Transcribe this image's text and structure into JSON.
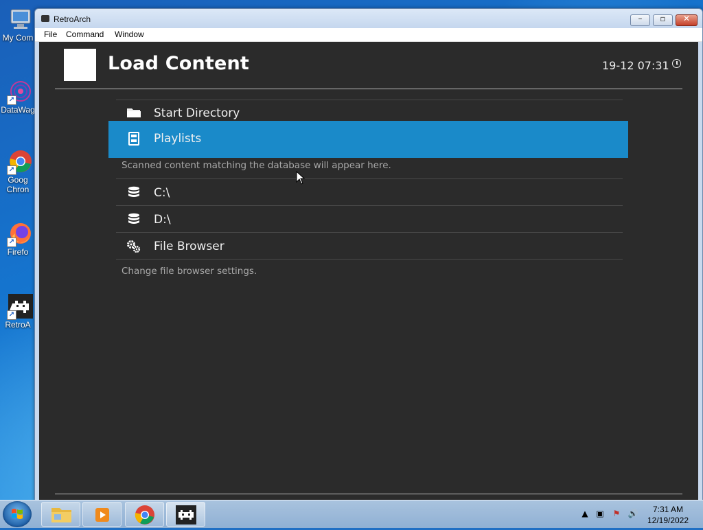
{
  "desktop": {
    "icons": [
      {
        "label": "My Com",
        "icon": "computer-icon"
      },
      {
        "label": "DataWag",
        "icon": "datawagon-icon"
      },
      {
        "label": "Goog",
        "label2": "Chron",
        "icon": "chrome-icon"
      },
      {
        "label": "Firefo",
        "icon": "firefox-icon"
      },
      {
        "label": "RetroA",
        "icon": "retroarch-icon"
      }
    ]
  },
  "window": {
    "title": "RetroArch",
    "menu": [
      "File",
      "Command",
      "Window"
    ]
  },
  "retroarch": {
    "page_title": "Load Content",
    "clock": "19-12 07:31",
    "entries": [
      {
        "label": "Start Directory",
        "icon": "folder-icon"
      },
      {
        "label": "Playlists",
        "icon": "playlist-icon",
        "selected": true,
        "sublabel": "Scanned content matching the database will appear here."
      },
      {
        "label": "C:\\",
        "icon": "drive-icon"
      },
      {
        "label": "D:\\",
        "icon": "drive-icon"
      },
      {
        "label": "File Browser",
        "icon": "settings-gears-icon",
        "sublabel": "Change file browser settings."
      }
    ],
    "selection_color": "#1a8ac9",
    "background_color": "#2b2b2b"
  },
  "taskbar": {
    "time": "7:31 AM",
    "date": "12/19/2022",
    "pinned": [
      "file-explorer-icon",
      "media-player-icon",
      "chrome-icon",
      "retroarch-icon"
    ]
  }
}
